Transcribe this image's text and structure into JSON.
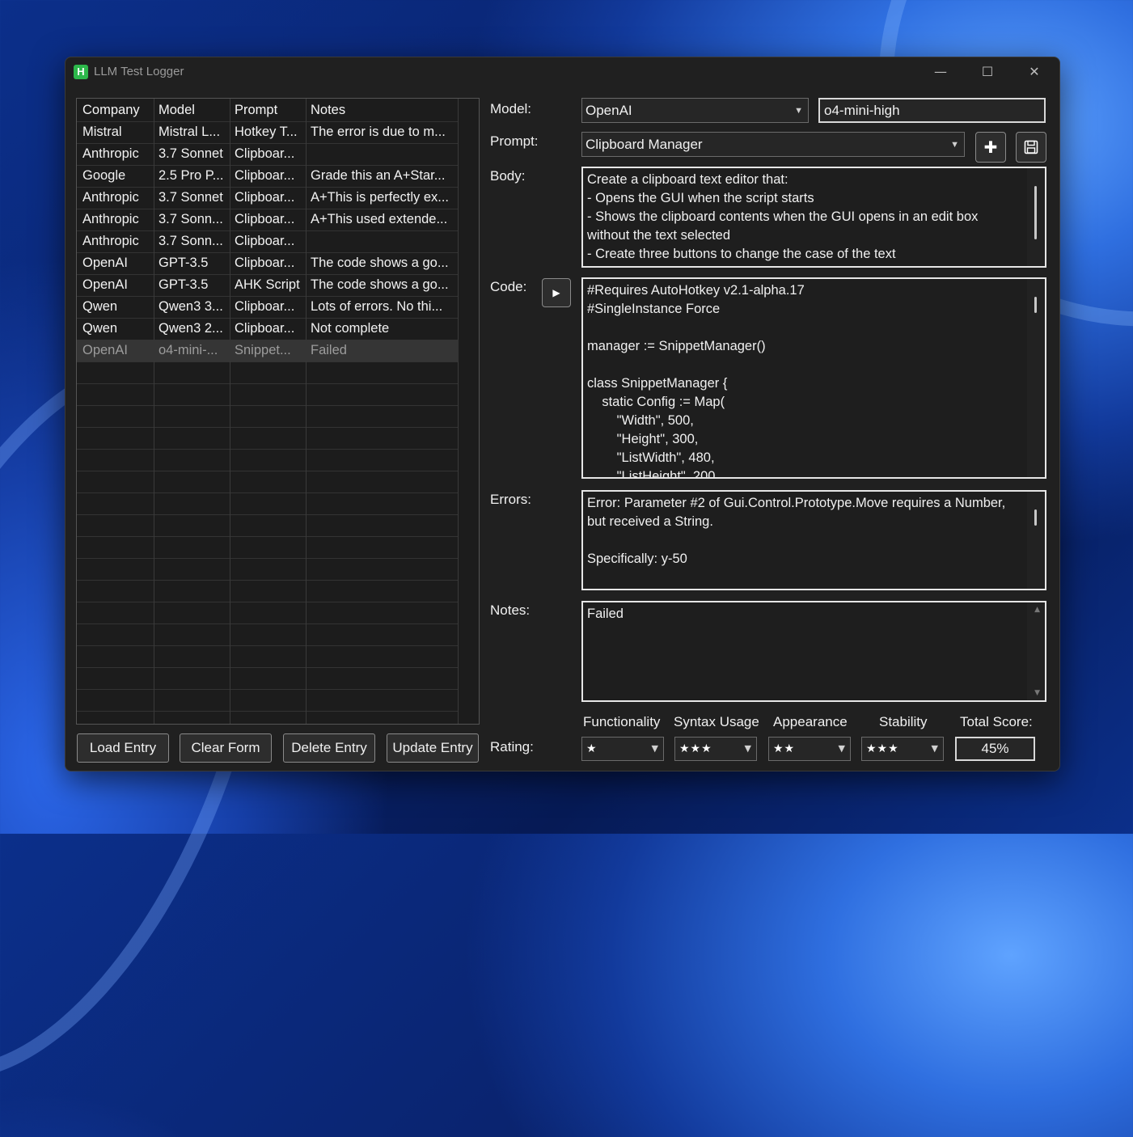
{
  "window": {
    "title": "LLM Test Logger",
    "icon_letter": "H",
    "controls": {
      "minimize": "—",
      "maximize": "☐",
      "close": "✕"
    }
  },
  "grid": {
    "headers": [
      "Company",
      "Model",
      "Prompt",
      "Notes"
    ],
    "rows": [
      [
        "Mistral",
        "Mistral L...",
        "Hotkey T...",
        "The error is due to m..."
      ],
      [
        "Anthropic",
        "3.7 Sonnet",
        "Clipboar...",
        ""
      ],
      [
        "Google",
        "2.5 Pro P...",
        "Clipboar...",
        "Grade this an A+Star..."
      ],
      [
        "Anthropic",
        "3.7 Sonnet",
        "Clipboar...",
        "A+This is perfectly ex..."
      ],
      [
        "Anthropic",
        "3.7 Sonn...",
        "Clipboar...",
        "A+This used extende..."
      ],
      [
        "Anthropic",
        "3.7 Sonn...",
        "Clipboar...",
        ""
      ],
      [
        "OpenAI",
        "GPT-3.5",
        "Clipboar...",
        "The code shows a go..."
      ],
      [
        "OpenAI",
        "GPT-3.5",
        "AHK Script",
        "The code shows a go..."
      ],
      [
        "Qwen",
        "Qwen3 3...",
        "Clipboar...",
        "Lots of errors. No thi..."
      ],
      [
        "Qwen",
        "Qwen3 2...",
        "Clipboar...",
        "Not complete"
      ]
    ],
    "selected_row": [
      "OpenAI",
      "o4-mini-...",
      "Snippet...",
      "Failed"
    ]
  },
  "buttons": {
    "load": "Load Entry",
    "clear": "Clear Form",
    "delete": "Delete Entry",
    "update": "Update Entry"
  },
  "form": {
    "labels": {
      "model": "Model:",
      "prompt": "Prompt:",
      "body": "Body:",
      "code": "Code:",
      "errors": "Errors:",
      "notes": "Notes:",
      "rating": "Rating:"
    },
    "company_value": "OpenAI",
    "model_value": "o4-mini-high",
    "prompt_value": "Clipboard Manager",
    "body_text": "Create a clipboard text editor that:\n- Opens the GUI when the script starts\n- Shows the clipboard contents when the GUI opens in an edit box\nwithout the text selected\n- Create three buttons to change the case of the text",
    "code_text": "#Requires AutoHotkey v2.1-alpha.17\n#SingleInstance Force\n\nmanager := SnippetManager()\n\nclass SnippetManager {\n    static Config := Map(\n        \"Width\", 500,\n        \"Height\", 300,\n        \"ListWidth\", 480,\n        \"ListHeight\", 200,",
    "errors_text": "Error: Parameter #2 of Gui.Control.Prototype.Move requires a Number,\nbut received a String.\n\nSpecifically: y-50",
    "notes_text": "Failed"
  },
  "ratings": {
    "headers": [
      "Functionality",
      "Syntax Usage",
      "Appearance",
      "Stability",
      "Total Score:"
    ],
    "functionality": "★",
    "syntax": "★★★",
    "appearance": "★★",
    "stability": "★★★",
    "total": "45%"
  },
  "icons": {
    "add": "plus-icon",
    "save": "floppy-disk-icon",
    "run": "play-arrow-icon",
    "dropdown": "chevron-down-icon"
  }
}
